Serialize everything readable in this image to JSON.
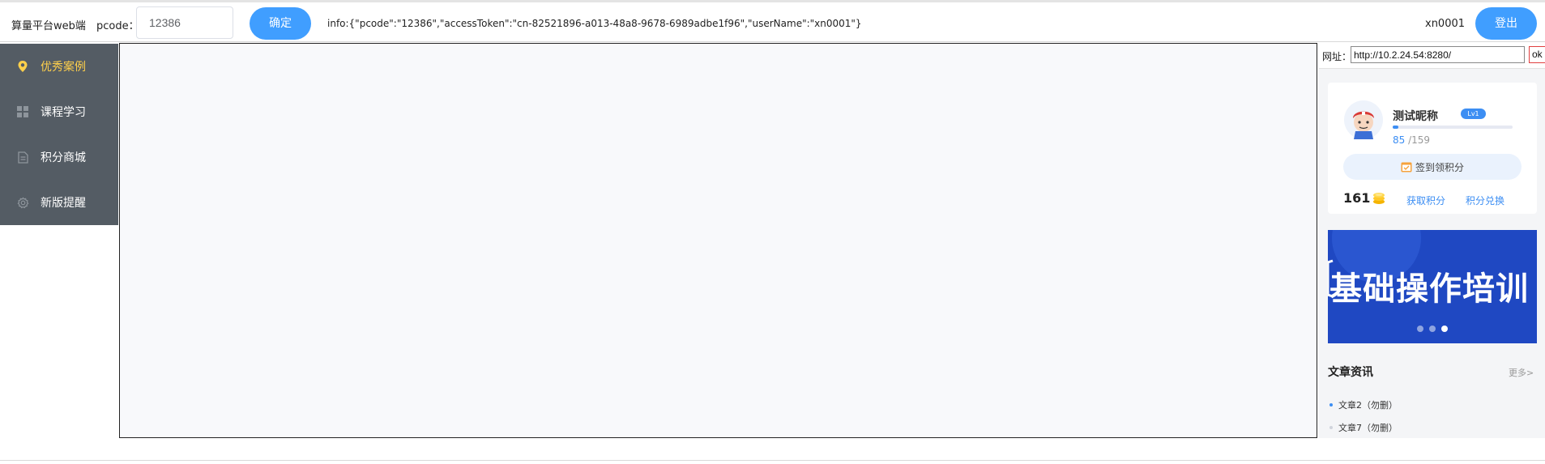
{
  "header": {
    "brand": "算量平台web端",
    "pcode_label": "pcode：",
    "pcode_value": "12386",
    "confirm_label": "确定",
    "info": "info:{\"pcode\":\"12386\",\"accessToken\":\"cn-82521896-a013-48a8-9678-6989adbe1f96\",\"userName\":\"xn0001\"}",
    "username": "xn0001",
    "logout_label": "登出"
  },
  "sidebar": {
    "items": [
      {
        "label": "优秀案例",
        "icon": "location-pin-icon",
        "active": true
      },
      {
        "label": "课程学习",
        "icon": "grid-icon",
        "active": false
      },
      {
        "label": "积分商城",
        "icon": "document-icon",
        "active": false
      },
      {
        "label": "新版提醒",
        "icon": "gear-icon",
        "active": false
      }
    ],
    "active_color": "#ffd04b",
    "bg_color": "#545c64"
  },
  "right_panel": {
    "url_label": "网址：",
    "url_value": "http://10.2.24.54:8280/",
    "ok_label": "ok",
    "user_card": {
      "nickname": "测试昵称",
      "level": "Lv1",
      "score_current": "85",
      "score_total": " /159",
      "progress_fraction": 0.05,
      "signin_label": "签到领积分",
      "points": "161",
      "earn_link": "获取积分",
      "exchange_link": "积分兑换"
    },
    "banner": {
      "text": "基础操作培训",
      "slide_count": 3,
      "active_slide": 3
    },
    "news": {
      "title": "文章资讯",
      "more": "更多>",
      "items": [
        {
          "title": "文章2（勿删）"
        },
        {
          "title": "文章7（勿删）"
        }
      ]
    },
    "accent_color": "#3c8ef3"
  }
}
